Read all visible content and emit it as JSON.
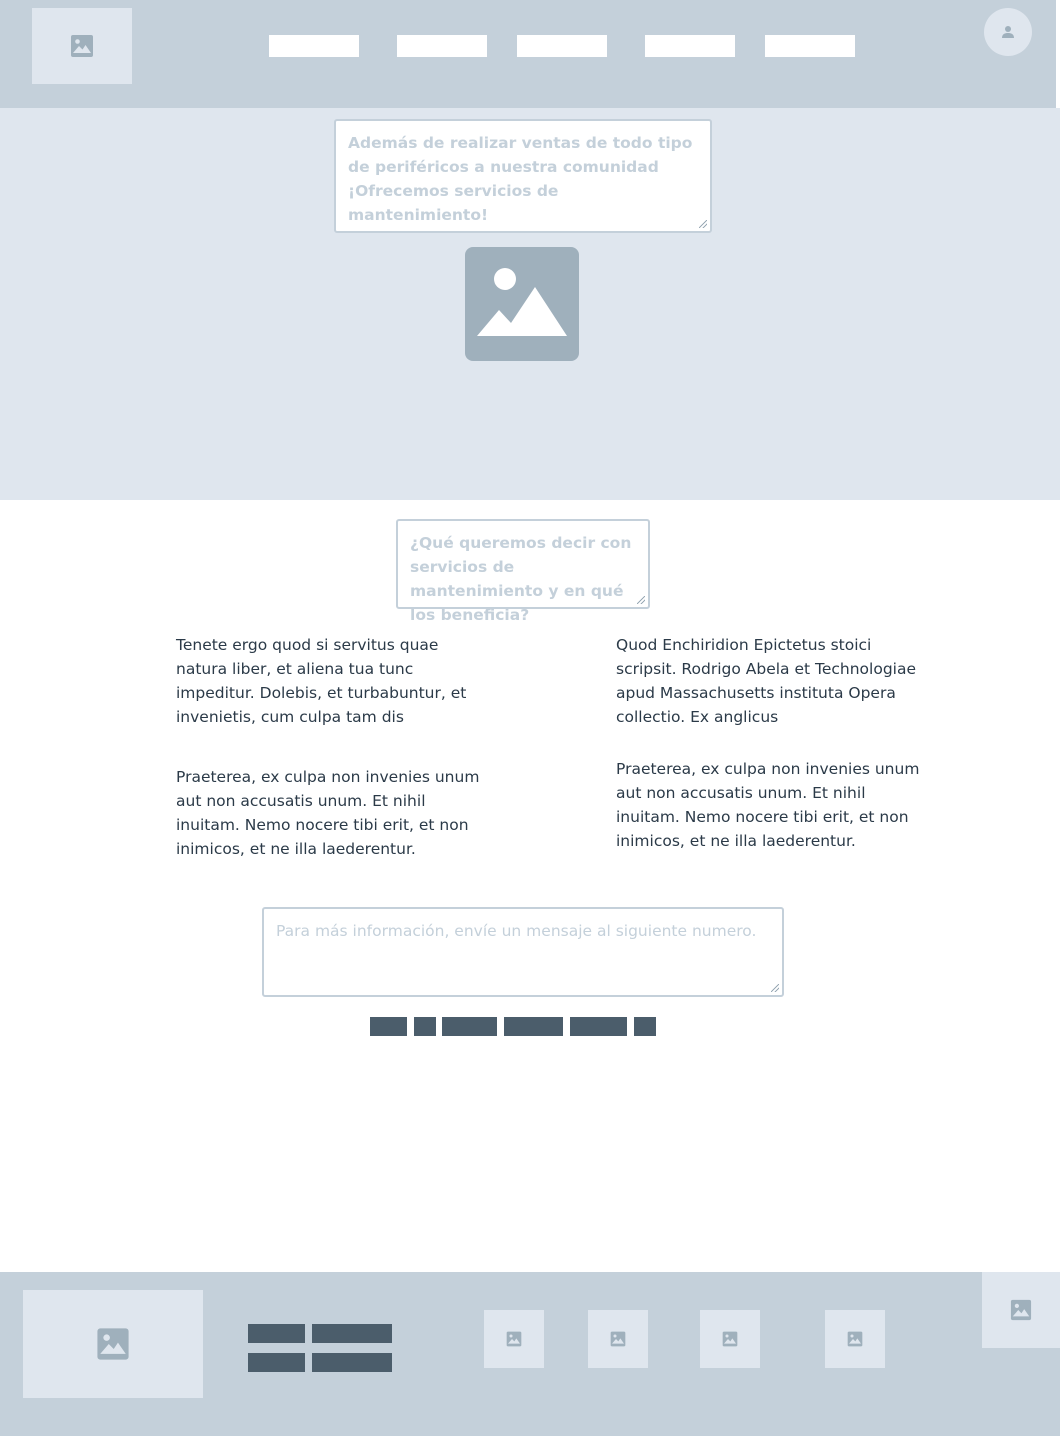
{
  "header": {
    "nav_items": [
      "",
      "",
      "",
      "",
      ""
    ]
  },
  "hero": {
    "intro_placeholder": "Además de realizar ventas de todo tipo de periféricos a nuestra comunidad ¡Ofrecemos servicios de mantenimiento!"
  },
  "services": {
    "question_placeholder": "¿Qué queremos decir con servicios de mantenimiento y en qué los beneficia?",
    "left_paragraphs": [
      "Tenete ergo quod si servitus quae natura liber, et aliena tua tunc impeditur. Dolebis, et turbabuntur, et invenietis, cum culpa tam dis",
      "Praeterea, ex culpa non invenies unum aut non accusatis unum. Et nihil inuitam. Nemo nocere tibi erit, et non inimicos, et ne illa laederentur."
    ],
    "right_paragraphs": [
      "Quod Enchiridion Epictetus stoici scripsit. Rodrigo Abela et Technologiae apud Massachusetts instituta Opera collectio. Ex anglicus",
      "Praeterea, ex culpa non invenies unum aut non accusatis unum. Et nihil inuitam. Nemo nocere tibi erit, et non inimicos, et ne illa laederentur."
    ]
  },
  "contact": {
    "message_placeholder": "Para más información, envíe un mensaje al siguiente numero."
  },
  "icons": {
    "image": "image-icon",
    "user": "user-icon"
  },
  "colors": {
    "header_bg": "#c4d0da",
    "hero_bg": "#dfe6ee",
    "placeholder_text": "#c4d0da",
    "body_text": "#2b3a48",
    "dark_block": "#4b5d6b"
  }
}
